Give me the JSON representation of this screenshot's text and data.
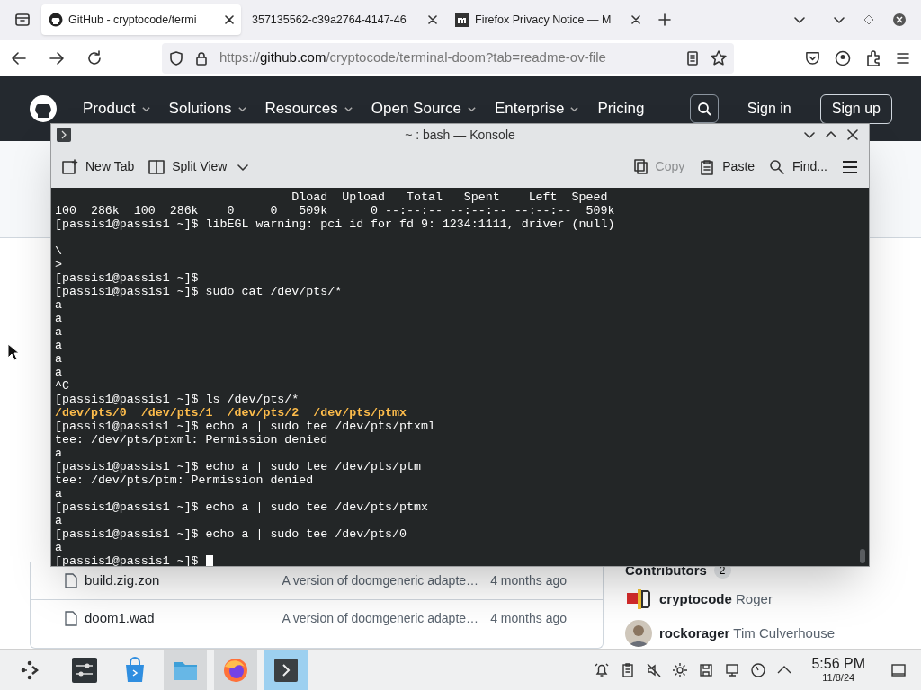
{
  "browser": {
    "tabs": [
      {
        "title": "GitHub - cryptocode/termi",
        "kind": "github",
        "selected": true
      },
      {
        "title": "357135562-c39a2764-4147-46",
        "kind": "plain",
        "selected": false
      },
      {
        "title": "Firefox Privacy Notice — M",
        "kind": "mozilla",
        "selected": false
      }
    ],
    "url": {
      "scheme": "https://",
      "host": "github.com",
      "path": "/cryptocode/terminal-doom?tab=readme-ov-file"
    }
  },
  "github_header": {
    "nav": [
      {
        "label": "Product",
        "dropdown": true
      },
      {
        "label": "Solutions",
        "dropdown": true
      },
      {
        "label": "Resources",
        "dropdown": true
      },
      {
        "label": "Open Source",
        "dropdown": true
      },
      {
        "label": "Enterprise",
        "dropdown": true
      },
      {
        "label": "Pricing",
        "dropdown": false
      }
    ],
    "sign_in": "Sign in",
    "sign_up": "Sign up"
  },
  "files": [
    {
      "name": "build.zig.zon",
      "message": "A version of doomgeneric adapte…",
      "time": "4 months ago"
    },
    {
      "name": "doom1.wad",
      "message": "A version of doomgeneric adapte…",
      "time": "4 months ago"
    }
  ],
  "contributors": {
    "title": "Contributors",
    "count": "2",
    "people": [
      {
        "login": "cryptocode",
        "name": "Roger",
        "kind": "pattern"
      },
      {
        "login": "rockorager",
        "name": "Tim Culverhouse",
        "kind": "person"
      }
    ]
  },
  "konsole": {
    "title": "~ : bash — Konsole",
    "toolbar": [
      {
        "label": "New Tab",
        "kind": "newtab",
        "disabled": false
      },
      {
        "label": "Split View",
        "kind": "split",
        "disabled": false
      },
      {
        "label": "Copy",
        "kind": "copy",
        "disabled": true
      },
      {
        "label": "Paste",
        "kind": "paste",
        "disabled": false
      },
      {
        "label": "Find...",
        "kind": "find",
        "disabled": false
      }
    ],
    "lines": [
      {
        "text": "                                 Dload  Upload   Total   Spent    Left  Speed",
        "kind": "plain"
      },
      {
        "text": "100  286k  100  286k    0     0   509k      0 --:--:-- --:--:-- --:--:--  509k",
        "kind": "plain"
      },
      {
        "text": "[passis1@passis1 ~]$ libEGL warning: pci id for fd 9: 1234:1111, driver (null)",
        "kind": "plain"
      },
      {
        "text": "\\",
        "kind": "plain",
        "blank_before": true
      },
      {
        "text": ">",
        "kind": "plain"
      },
      {
        "text": "[passis1@passis1 ~]$",
        "kind": "plain"
      },
      {
        "text": "[passis1@passis1 ~]$ sudo cat /dev/pts/*",
        "kind": "plain"
      },
      {
        "text": "a",
        "kind": "plain"
      },
      {
        "text": "a",
        "kind": "plain"
      },
      {
        "text": "a",
        "kind": "plain"
      },
      {
        "text": "a",
        "kind": "plain"
      },
      {
        "text": "a",
        "kind": "plain"
      },
      {
        "text": "a",
        "kind": "plain"
      },
      {
        "text": "^C",
        "kind": "plain"
      },
      {
        "text": "[passis1@passis1 ~]$ ls /dev/pts/*",
        "kind": "plain"
      },
      {
        "text": "/dev/pts/0  /dev/pts/1  /dev/pts/2  /dev/pts/ptmx",
        "kind": "listing"
      },
      {
        "text": "[passis1@passis1 ~]$ echo a | sudo tee /dev/pts/ptxml",
        "kind": "plain"
      },
      {
        "text": "tee: /dev/pts/ptxml: Permission denied",
        "kind": "plain"
      },
      {
        "text": "a",
        "kind": "plain"
      },
      {
        "text": "[passis1@passis1 ~]$ echo a | sudo tee /dev/pts/ptm",
        "kind": "plain"
      },
      {
        "text": "tee: /dev/pts/ptm: Permission denied",
        "kind": "plain"
      },
      {
        "text": "a",
        "kind": "plain"
      },
      {
        "text": "[passis1@passis1 ~]$ echo a | sudo tee /dev/pts/ptmx",
        "kind": "plain"
      },
      {
        "text": "a",
        "kind": "plain"
      },
      {
        "text": "[passis1@passis1 ~]$ echo a | sudo tee /dev/pts/0",
        "kind": "plain"
      },
      {
        "text": "a",
        "kind": "plain"
      },
      {
        "text": "[passis1@passis1 ~]$",
        "kind": "prompt"
      }
    ]
  },
  "taskbar": {
    "apps": [
      {
        "kind": "settings",
        "running": false,
        "selected": false
      },
      {
        "kind": "store",
        "running": false,
        "selected": false
      },
      {
        "kind": "files",
        "running": true,
        "selected": false
      },
      {
        "kind": "firefox",
        "running": true,
        "selected": false
      },
      {
        "kind": "terminal",
        "running": true,
        "selected": true
      }
    ],
    "time": "5:56 PM",
    "date": "11/8/24"
  }
}
